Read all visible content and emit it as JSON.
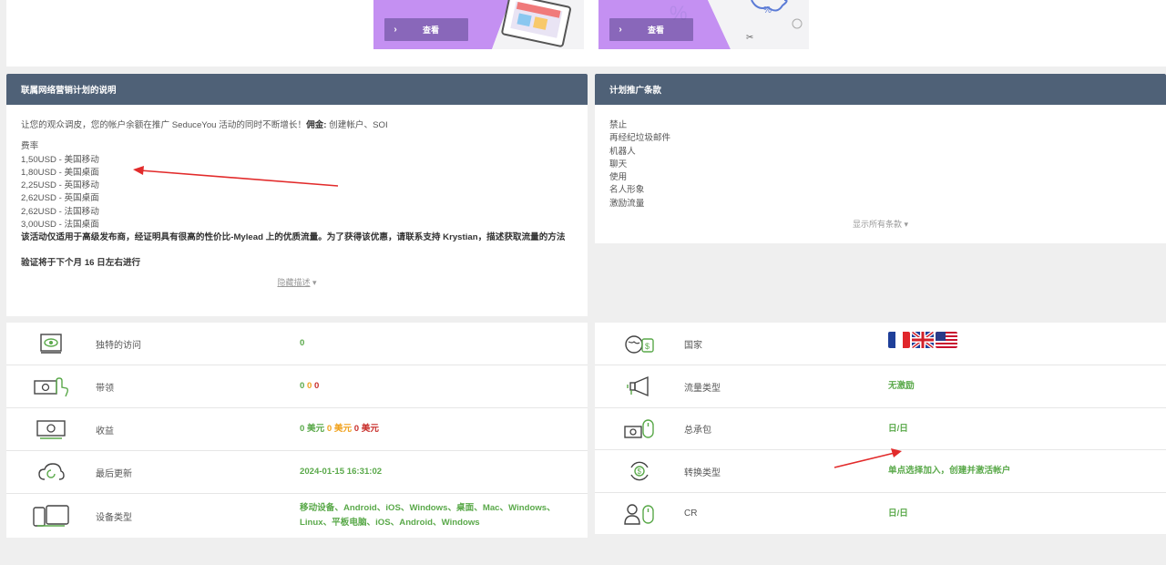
{
  "banners": [
    {
      "view_label": "查看"
    },
    {
      "view_label": "查看"
    }
  ],
  "description_panel": {
    "title": "联属网络营销计划的说明",
    "intro_text": "让您的观众调皮，您的帐户余额在推广 SeduceYou 活动的同时不断增长！",
    "commission_label": "佣金:",
    "commission_value": " 创建帐户、SOI",
    "rates_label": "费率",
    "rates": [
      "1,50USD - 美国移动",
      "1,80USD - 美国桌面",
      "2,25USD - 英国移动",
      "2,62USD - 英国桌面",
      "2,62USD - 法国移动",
      "3,00USD - 法国桌面"
    ],
    "note": "该活动仅适用于高级发布商，经证明具有很高的性价比-Mylead 上的优质流量。为了获得该优惠，请联系支持 Krystian，描述获取流量的方法",
    "verification": "验证将于下个月 16 日左右进行",
    "hide_link": "隐藏描述"
  },
  "terms_panel": {
    "title": "计划推广条款",
    "items": [
      "禁止",
      "再经纪垃圾邮件",
      "机器人",
      "聊天",
      "使用",
      "名人形象",
      "激励流量"
    ],
    "show_all_link": "显示所有条款"
  },
  "left_stats": [
    {
      "icon": "eye-screen-icon",
      "label": "独特的访问",
      "value": "0"
    },
    {
      "icon": "money-click-icon",
      "label": "带领",
      "values": [
        "0",
        "0",
        "0"
      ]
    },
    {
      "icon": "banknote-icon",
      "label": "收益",
      "values": [
        "0 美元",
        "0 美元",
        "0 美元"
      ]
    },
    {
      "icon": "cloud-sync-icon",
      "label": "最后更新",
      "value": "2024-01-15 16:31:02"
    },
    {
      "icon": "devices-icon",
      "label": "设备类型",
      "value": "移动设备、Android、iOS、Windows、桌面、Mac、Windows、Linux、平板电脑、iOS、Android、Windows"
    }
  ],
  "right_stats": [
    {
      "icon": "globe-money-icon",
      "label": "国家",
      "flags": [
        "France",
        "United Kingdom",
        "United States"
      ]
    },
    {
      "icon": "megaphone-icon",
      "label": "流量类型",
      "value": "无激励"
    },
    {
      "icon": "money-mouse-icon",
      "label": "总承包",
      "value": "日/日"
    },
    {
      "icon": "conversion-cycle-icon",
      "label": "转换类型",
      "value": "单点选择加入，创建并激活帐户"
    },
    {
      "icon": "user-mouse-icon",
      "label": "CR",
      "value": "日/日"
    }
  ],
  "colors": {
    "header": "#4f6177",
    "green": "#5aa94a",
    "orange": "#f0a21e",
    "red": "#c9302c",
    "banner_purple": "#c48ef0"
  }
}
